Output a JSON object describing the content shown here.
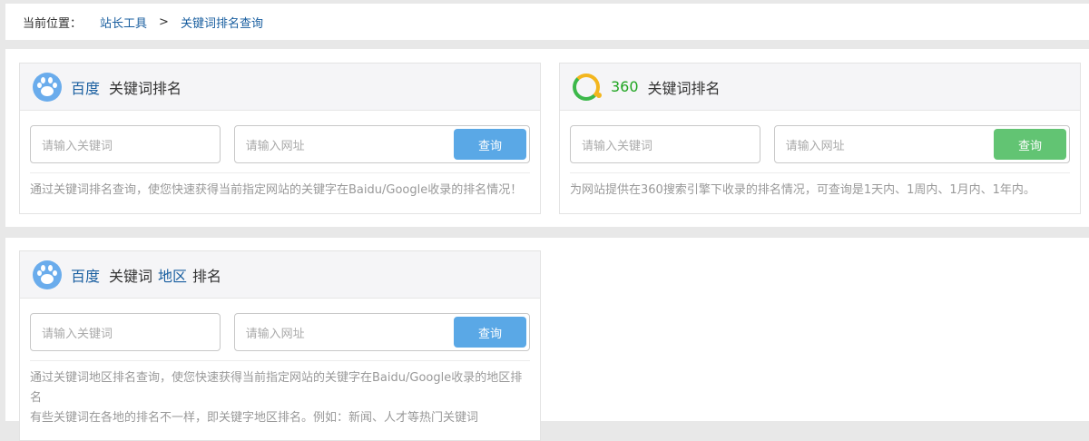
{
  "breadcrumb": {
    "label": "当前位置：",
    "home": "站长工具",
    "separator": ">",
    "current": "关键词排名查询"
  },
  "cards": {
    "baidu": {
      "icon": "baidu-paw-icon",
      "brand": "百度",
      "title": "关键词排名",
      "keyword_placeholder": "请输入关键词",
      "url_placeholder": "请输入网址",
      "button": "查询",
      "button_color": "#5aa8e6",
      "description": "通过关键词排名查询，使您快速获得当前指定网站的关键字在Baidu/Google收录的排名情况！"
    },
    "s360": {
      "icon": "360-ring-icon",
      "brand": "360",
      "title": "关键词排名",
      "keyword_placeholder": "请输入关键词",
      "url_placeholder": "请输入网址",
      "button": "查询",
      "button_color": "#62c473",
      "description": "为网站提供在360搜索引擎下收录的排名情况，可查询是1天内、1周内、1月内、1年内。"
    },
    "region": {
      "icon": "baidu-paw-icon",
      "brand": "百度",
      "title_part1": "关键词",
      "title_highlight": "地区",
      "title_part2": "排名",
      "keyword_placeholder": "请输入关键词",
      "url_placeholder": "请输入网址",
      "button": "查询",
      "button_color": "#5aa8e6",
      "description_line1": "通过关键词地区排名查询，使您快速获得当前指定网站的关键字在Baidu/Google收录的地区排名",
      "description_line2": "有些关键词在各地的排名不一样，即关键字地区排名。例如：新闻、人才等热门关键词"
    }
  }
}
